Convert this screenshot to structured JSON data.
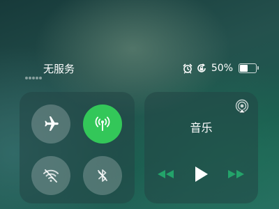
{
  "status_bar": {
    "carrier": "无服务",
    "battery_percent_label": "50%",
    "battery_level": 0.5,
    "signal_bars": 5,
    "alarm_icon": "alarm-clock-icon",
    "rotation_lock_icon": "rotation-lock-icon"
  },
  "connectivity": {
    "airplane": {
      "icon": "airplane-icon",
      "on": false
    },
    "cellular": {
      "icon": "cellular-antenna-icon",
      "on": true,
      "color": "#33c759"
    },
    "wifi": {
      "icon": "wifi-off-icon",
      "on": false
    },
    "bluetooth": {
      "icon": "bluetooth-off-icon",
      "on": false
    }
  },
  "music": {
    "title": "音乐",
    "airplay_icon": "airplay-icon",
    "prev_icon": "rewind-icon",
    "play_icon": "play-icon",
    "next_icon": "fast-forward-icon"
  }
}
